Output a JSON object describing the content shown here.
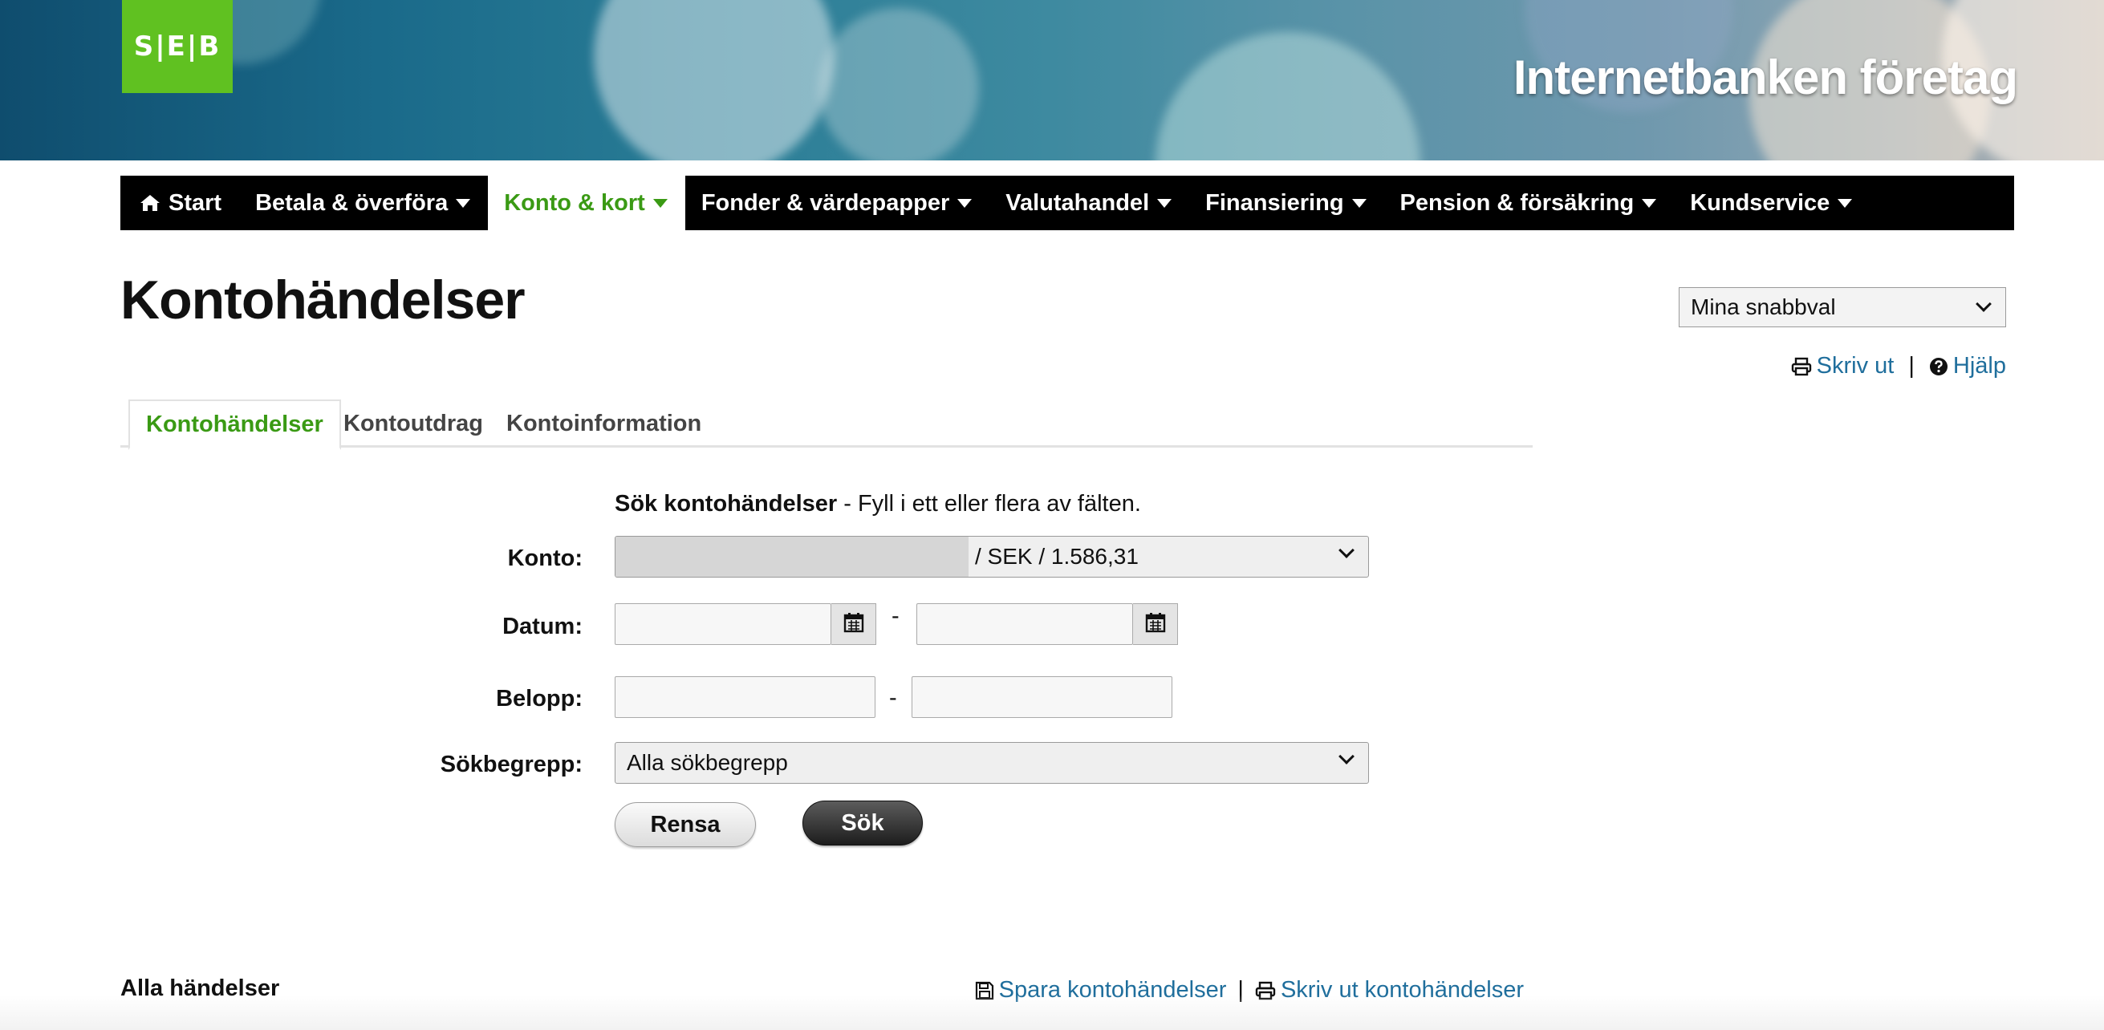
{
  "brand": {
    "logo_text": "S|E|B",
    "title": "Internetbanken företag",
    "logo_color": "#60c121"
  },
  "nav": {
    "items": [
      {
        "label": "Start",
        "icon": "home-icon",
        "active": false,
        "dropdown": false
      },
      {
        "label": "Betala & överföra",
        "active": false,
        "dropdown": true
      },
      {
        "label": "Konto & kort",
        "active": true,
        "dropdown": true
      },
      {
        "label": "Fonder & värdepapper",
        "active": false,
        "dropdown": true
      },
      {
        "label": "Valutahandel",
        "active": false,
        "dropdown": true
      },
      {
        "label": "Finansiering",
        "active": false,
        "dropdown": true
      },
      {
        "label": "Pension & försäkring",
        "active": false,
        "dropdown": true
      },
      {
        "label": "Kundservice",
        "active": false,
        "dropdown": true
      }
    ],
    "active_color": "#3a9a14"
  },
  "page": {
    "title": "Kontohändelser",
    "quick_select": "Mina snabbval",
    "print_label": "Skriv ut",
    "help_label": "Hjälp",
    "separator": "|"
  },
  "tabs": [
    {
      "label": "Kontohändelser",
      "active": true
    },
    {
      "label": "Kontoutdrag",
      "active": false
    },
    {
      "label": "Kontoinformation",
      "active": false
    }
  ],
  "form": {
    "intro_bold": "Sök kontohändelser",
    "intro_rest": " - Fyll i ett eller flera av fälten.",
    "account_label": "Konto:",
    "account_value": "/ SEK / 1.586,31",
    "date_label": "Datum:",
    "date_from": "",
    "date_to": "",
    "amount_label": "Belopp:",
    "amount_from": "",
    "amount_to": "",
    "range_dash": "-",
    "term_label": "Sökbegrepp:",
    "term_value": "Alla sökbegrepp",
    "clear_button": "Rensa",
    "search_button": "Sök"
  },
  "results": {
    "title": "Alla händelser",
    "save_link": "Spara kontohändelser",
    "print_link": "Skriv ut kontohändelser",
    "separator": "|"
  },
  "link_color": "#1f6e9c"
}
